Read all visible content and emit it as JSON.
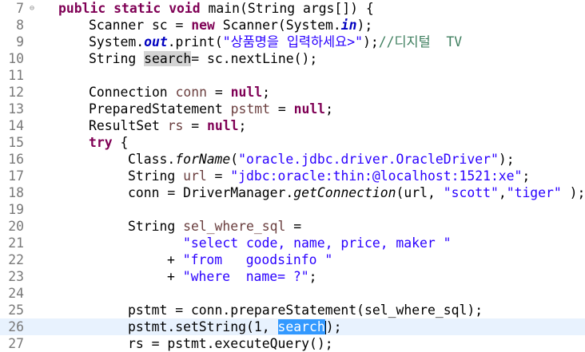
{
  "gutter": {
    "lines": [
      "7",
      "8",
      "9",
      "10",
      "11",
      "12",
      "13",
      "14",
      "15",
      "16",
      "17",
      "18",
      "19",
      "20",
      "21",
      "22",
      "23",
      "24",
      "25",
      "26",
      "27"
    ],
    "fold_marker": "⊖"
  },
  "code": {
    "l7": {
      "public": "public",
      "static": "static",
      "void": "void",
      "rest": " main(String args[]) {"
    },
    "l8": {
      "a": "Scanner sc = ",
      "new": "new",
      "b": " Scanner(System.",
      "in": "in",
      "c": ");"
    },
    "l9": {
      "a": "System.",
      "out": "out",
      "b": ".print(",
      "str": "\"상품명을 입력하세요>\"",
      "c": ");",
      "cmt": "//디지털  TV"
    },
    "l10": {
      "a": "String ",
      "search": "search",
      "b": "= sc.nextLine();"
    },
    "l12": {
      "a": "Connection ",
      "var": "conn",
      "b": " = ",
      "null": "null",
      "c": ";"
    },
    "l13": {
      "a": "PreparedStatement ",
      "var": "pstmt",
      "b": " = ",
      "null": "null",
      "c": ";"
    },
    "l14": {
      "a": "ResultSet ",
      "var": "rs",
      "b": " = ",
      "null": "null",
      "c": ";"
    },
    "l15": {
      "try": "try",
      "rest": " {"
    },
    "l16": {
      "a": "Class.",
      "m": "forName",
      "b": "(",
      "str": "\"oracle.jdbc.driver.OracleDriver\"",
      "c": ");"
    },
    "l17": {
      "a": "String ",
      "var": "url",
      "b": " = ",
      "str": "\"jdbc:oracle:thin:@localhost:1521:xe\"",
      "c": ";"
    },
    "l18": {
      "a": "conn = DriverManager.",
      "m": "getConnection",
      "b": "(url, ",
      "s1": "\"scott\"",
      "comma": ",",
      "s2": "\"tiger\"",
      "c": " );"
    },
    "l20": {
      "a": "String ",
      "var": "sel_where_sql",
      "b": " ="
    },
    "l21": {
      "str": "\"select code, name, price, maker \""
    },
    "l22": {
      "plus": "+ ",
      "str": "\"from   goodsinfo \""
    },
    "l23": {
      "plus": "+ ",
      "str": "\"where  name= ?\"",
      "c": ";"
    },
    "l25": {
      "a": "pstmt = conn.prepareStatement(sel_where_sql);"
    },
    "l26": {
      "a": "pstmt.setString(1, ",
      "search": "search",
      "c": ");"
    },
    "l27": {
      "a": "rs = pstmt.executeQuery();"
    }
  },
  "colors": {
    "keyword": "#7f0055",
    "string": "#2a00ff",
    "comment": "#3f7f5f",
    "field": "#0000c0",
    "selection": "#3399ff",
    "occurrence": "#d4d4d4",
    "current_line": "#e8f2fe"
  }
}
